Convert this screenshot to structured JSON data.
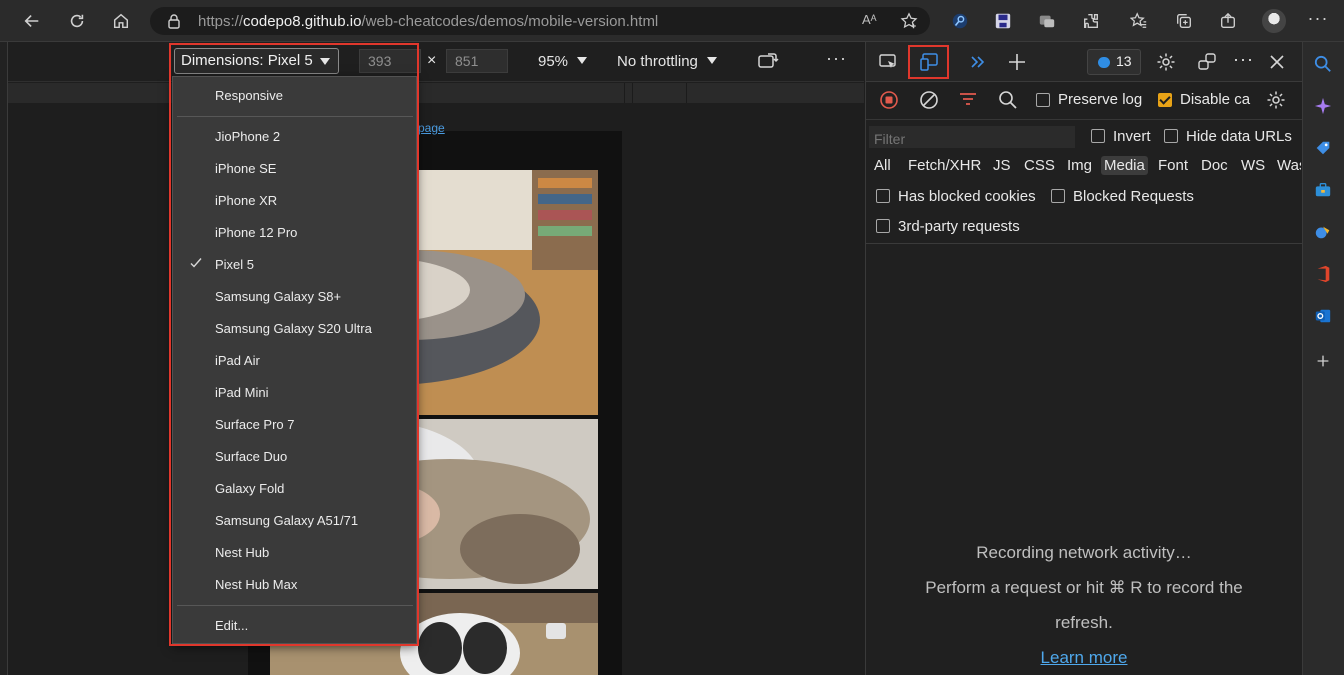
{
  "browser": {
    "url_scheme": "https://",
    "url_host": "codepo8.github.io",
    "url_path": "/web-cheatcodes/demos/mobile-version.html",
    "read_aloud_label": "Aᴬ"
  },
  "emulation": {
    "dimensions_label": "Dimensions: Pixel 5",
    "width_value": "393",
    "height_value": "851",
    "times_sign": "×",
    "zoom_label": "95%",
    "throttling_label": "No throttling",
    "more_label": "···"
  },
  "device_menu": {
    "responsive": "Responsive",
    "devices": [
      "JioPhone 2",
      "iPhone SE",
      "iPhone XR",
      "iPhone 12 Pro",
      "Pixel 5",
      "Samsung Galaxy S8+",
      "Samsung Galaxy S20 Ultra",
      "iPad Air",
      "iPad Mini",
      "Surface Pro 7",
      "Surface Duo",
      "Galaxy Fold",
      "Samsung Galaxy A51/71",
      "Nest Hub",
      "Nest Hub Max"
    ],
    "selected": "Pixel 5",
    "edit": "Edit..."
  },
  "page": {
    "link_text": "page"
  },
  "devtools": {
    "issues_count": "13",
    "more_label": "···",
    "preserve_log": "Preserve log",
    "disable_cache": "Disable ca",
    "filter_placeholder": "Filter",
    "invert": "Invert",
    "hide_data_urls": "Hide data URLs",
    "types": [
      "All",
      "Fetch/XHR",
      "JS",
      "CSS",
      "Img",
      "Media",
      "Font",
      "Doc",
      "WS",
      "Was"
    ],
    "active_type": "Media",
    "has_blocked_cookies": "Has blocked cookies",
    "blocked_requests": "Blocked Requests",
    "third_party": "3rd-party requests",
    "empty_title": "Recording network activity…",
    "empty_line_1": "Perform a request or hit ⌘ R to record the",
    "empty_line_2": "refresh.",
    "learn_more": "Learn more"
  },
  "colors": {
    "highlight_outline": "#e0372c",
    "checkbox_checked": "#e8a317",
    "link": "#4fa8ec",
    "record_stop": "#e25a4d",
    "active_blue": "#3e8ee6"
  }
}
